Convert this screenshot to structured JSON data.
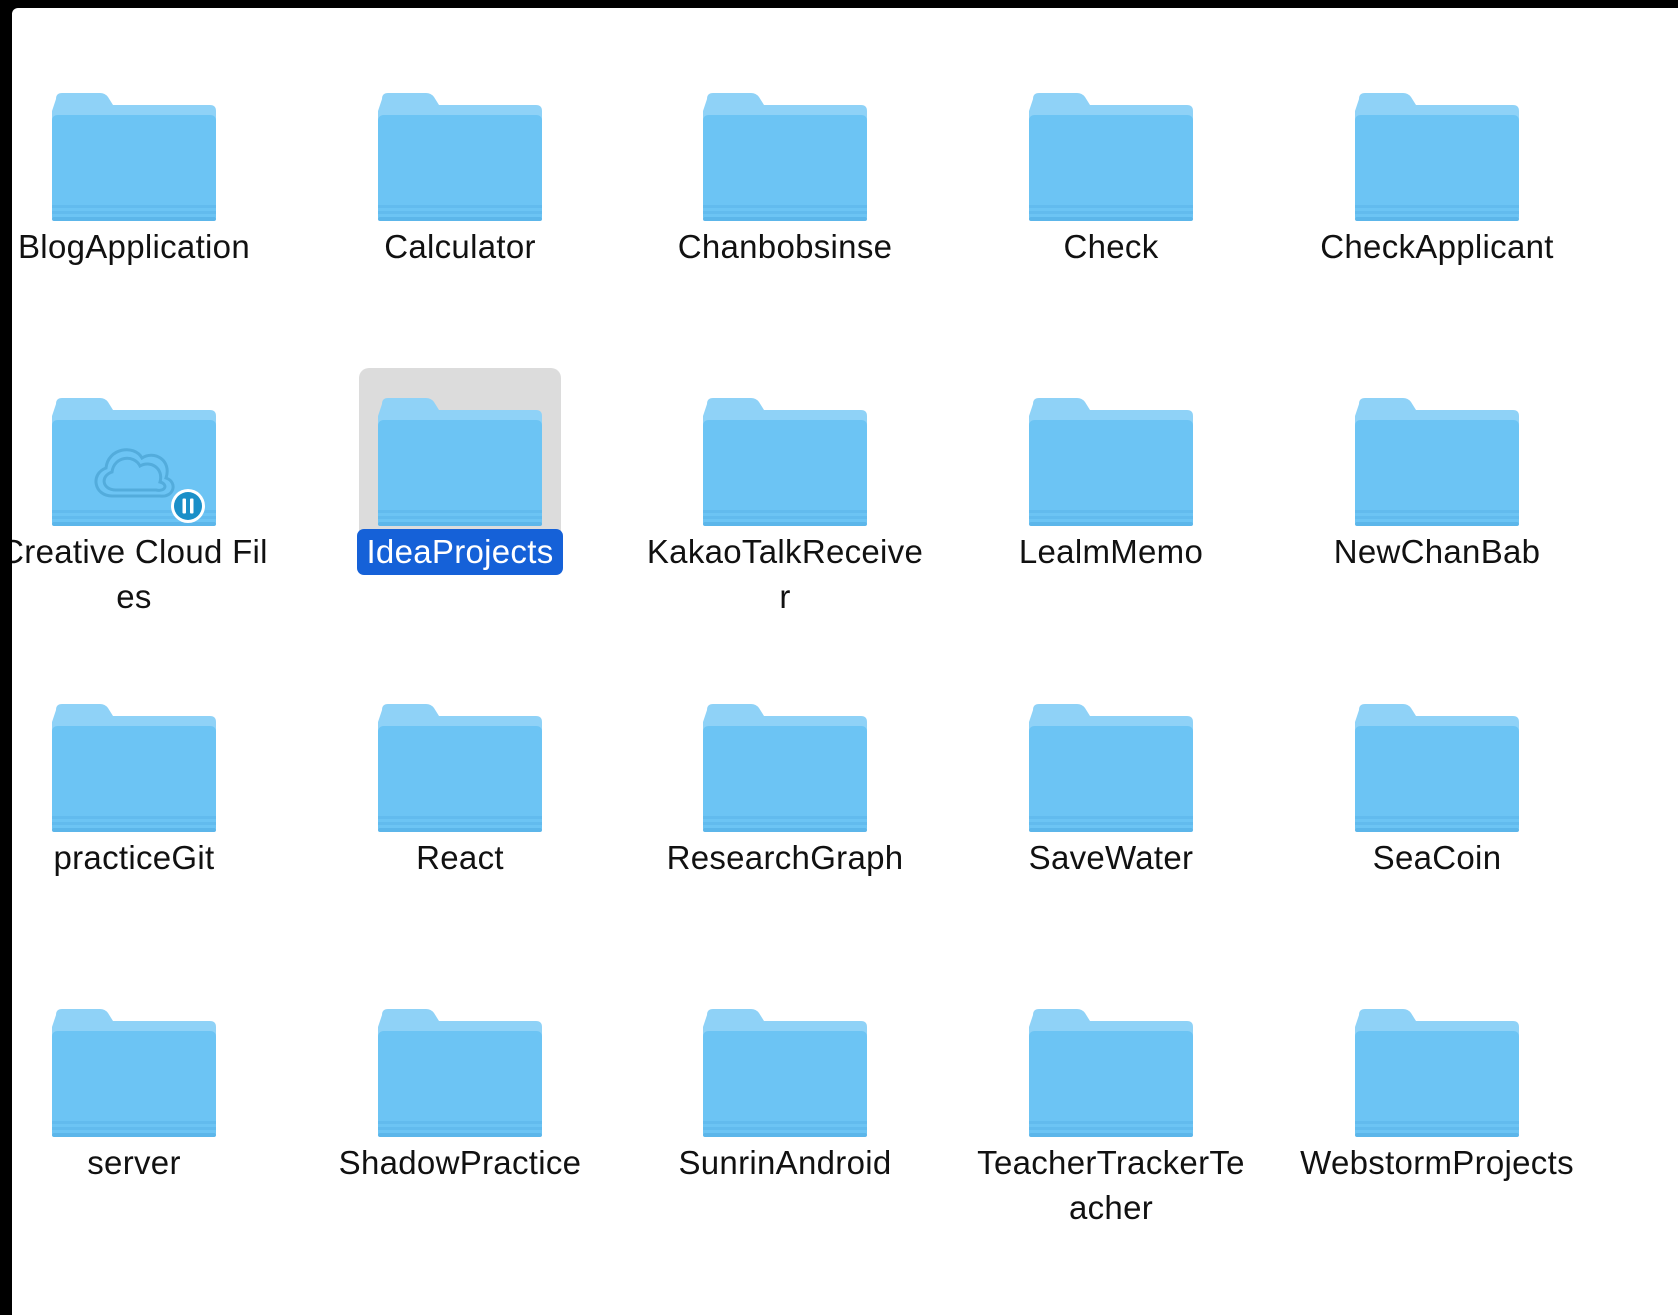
{
  "folders": [
    {
      "label": "BlogApplication",
      "icon": "folder-icon"
    },
    {
      "label": "Calculator",
      "icon": "folder-icon"
    },
    {
      "label": "Chanbobsinse",
      "icon": "folder-icon"
    },
    {
      "label": "Check",
      "icon": "folder-icon"
    },
    {
      "label": "CheckApplicant",
      "icon": "folder-icon"
    },
    {
      "label": "Creative Cloud Files",
      "icon": "creative-cloud-folder-icon",
      "badge": "sync-paused-icon"
    },
    {
      "label": "IdeaProjects",
      "icon": "folder-icon",
      "selected": true
    },
    {
      "label": "KakaoTalkReceiver",
      "icon": "folder-icon"
    },
    {
      "label": "LealmMemo",
      "icon": "folder-icon"
    },
    {
      "label": "NewChanBab",
      "icon": "folder-icon"
    },
    {
      "label": "practiceGit",
      "icon": "folder-icon"
    },
    {
      "label": "React",
      "icon": "folder-icon"
    },
    {
      "label": "ResearchGraph",
      "icon": "folder-icon"
    },
    {
      "label": "SaveWater",
      "icon": "folder-icon"
    },
    {
      "label": "SeaCoin",
      "icon": "folder-icon"
    },
    {
      "label": "server",
      "icon": "folder-icon"
    },
    {
      "label": "ShadowPractice",
      "icon": "folder-icon"
    },
    {
      "label": "SunrinAndroid",
      "icon": "folder-icon"
    },
    {
      "label": "TeacherTrackerTeacher",
      "icon": "folder-icon"
    },
    {
      "label": "WebstormProjects",
      "icon": "folder-icon"
    }
  ],
  "colors": {
    "folder_back": "#8fd2f7",
    "folder_front": "#6cc4f4",
    "folder_front_bottom": "#5cb6ea",
    "selection_highlight": "#1561d8",
    "icon_selection_bg": "#dcdcdc",
    "badge": "#1a8fc8"
  }
}
